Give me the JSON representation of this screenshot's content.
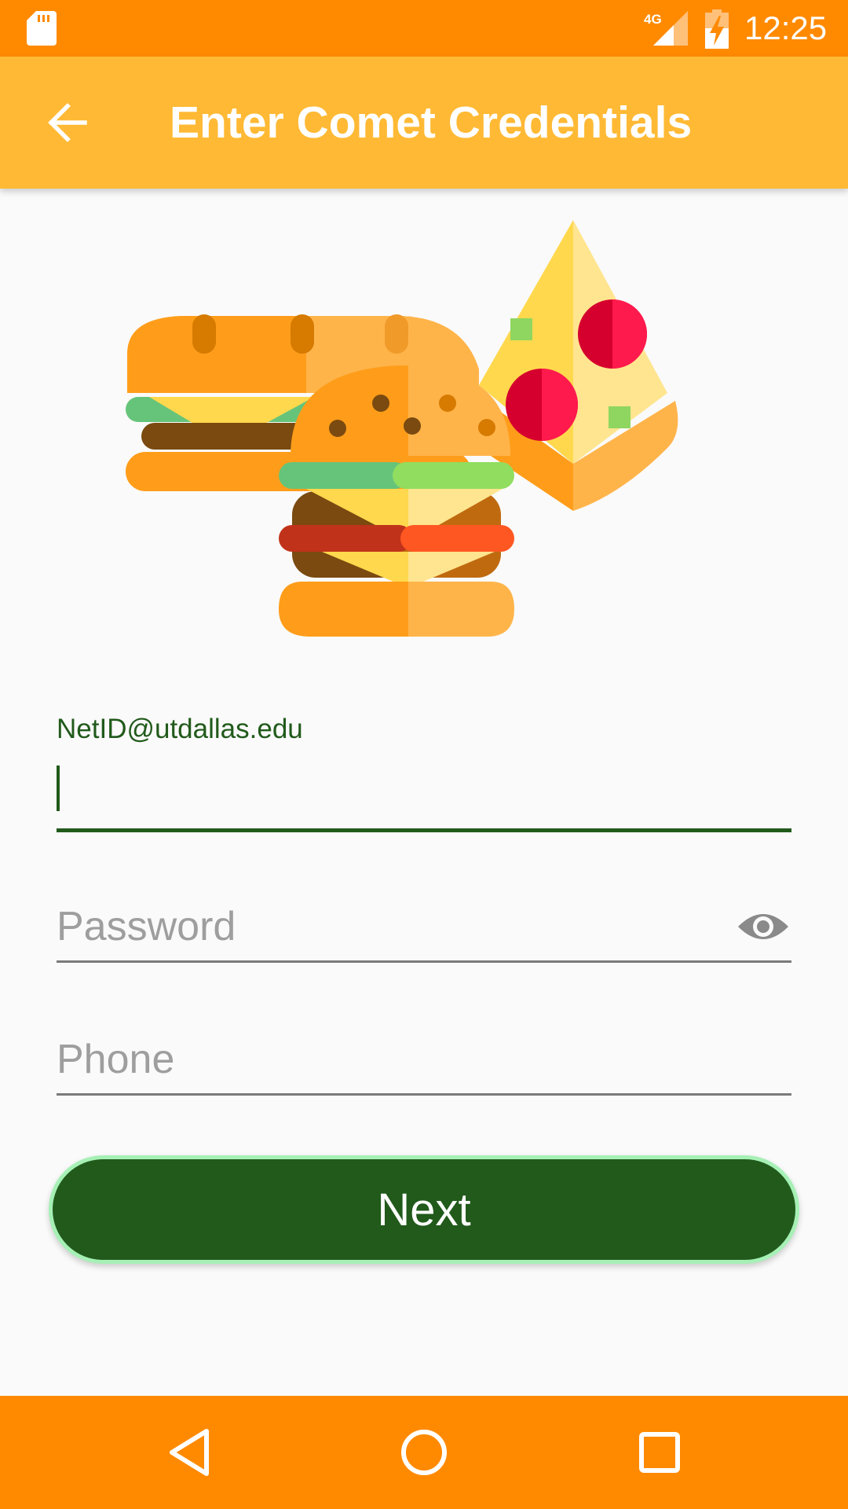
{
  "status_bar": {
    "network_label": "4G",
    "time": "12:25",
    "background_color": "#ff8a00",
    "icons": [
      "sd-card-icon",
      "signal-icon",
      "battery-charging-icon"
    ]
  },
  "app_bar": {
    "title": "Enter Comet Credentials",
    "back_icon": "arrow-back-icon",
    "background_color": "#ffb934"
  },
  "illustration": {
    "content": "food-illustration-burgers-pizza"
  },
  "form": {
    "netid": {
      "label": "NetID@utdallas.edu",
      "value": "",
      "focused": true
    },
    "password": {
      "placeholder": "Password",
      "value": "",
      "toggle_icon": "eye-icon"
    },
    "phone": {
      "placeholder": "Phone",
      "value": ""
    },
    "accent_color": "#215a1b"
  },
  "next_button": {
    "label": "Next",
    "color": "#215a1b"
  },
  "nav_bar": {
    "background_color": "#ff8a00",
    "buttons": [
      "back-triangle-icon",
      "home-circle-icon",
      "recents-square-icon"
    ]
  }
}
